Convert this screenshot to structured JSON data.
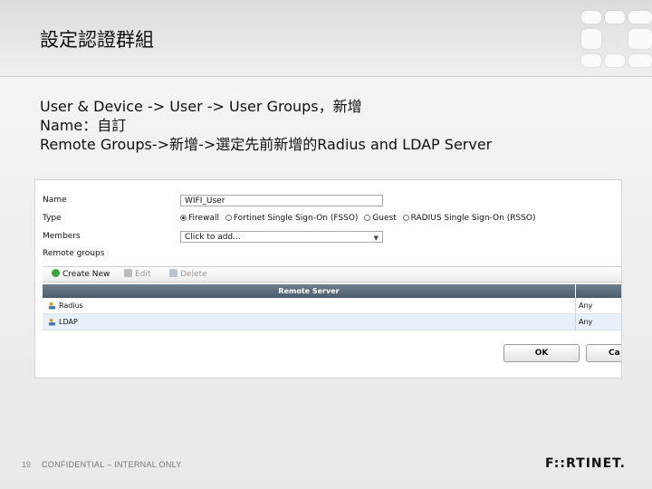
{
  "slide": {
    "title": "設定認證群組",
    "lines": [
      "User & Device -> User -> User Groups，新增",
      "Name：自訂",
      "Remote Groups->新增->選定先前新增的Radius and LDAP Server"
    ]
  },
  "dialog": {
    "name_label": "Name",
    "name_value": "WIFI_User",
    "type_label": "Type",
    "type_options": [
      "Firewall",
      "Fortinet Single Sign-On (FSSO)",
      "Guest",
      "RADIUS Single Sign-On (RSSO)"
    ],
    "type_selected": "Firewall",
    "members_label": "Members",
    "members_placeholder": "Click to add...",
    "remote_groups_label": "Remote groups",
    "toolbar": {
      "create_new": "Create New",
      "edit": "Edit",
      "delete": "Delete"
    },
    "table": {
      "columns": [
        "Remote Server",
        ""
      ],
      "rows": [
        {
          "server": "Radius",
          "group": "Any"
        },
        {
          "server": "LDAP",
          "group": "Any"
        }
      ]
    },
    "ok_label": "OK",
    "cancel_label": "Ca"
  },
  "footer": {
    "page_number": "19",
    "confidential": "CONFIDENTIAL – INTERNAL ONLY",
    "brand": "F::RTINET."
  }
}
